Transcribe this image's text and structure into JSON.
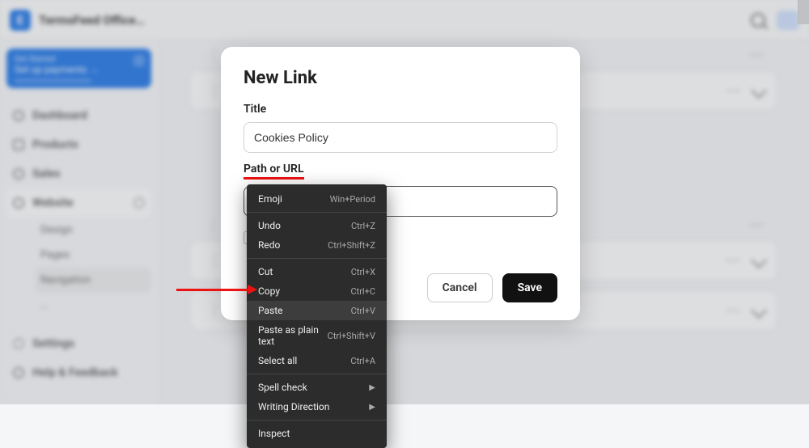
{
  "topbar": {
    "logo_letter": "E",
    "site_name": "TermsFeed Office…"
  },
  "sidebar": {
    "get_started": {
      "small": "Get Started",
      "main": "Set up payments  →"
    },
    "items": [
      {
        "label": "Dashboard"
      },
      {
        "label": "Products"
      },
      {
        "label": "Sales"
      },
      {
        "label": "Website"
      }
    ],
    "website_sub": [
      {
        "label": "Design"
      },
      {
        "label": "Pages"
      },
      {
        "label": "Navigation",
        "active": true
      }
    ],
    "bottom": [
      {
        "label": "Settings"
      },
      {
        "label": "Help & Feedback"
      }
    ]
  },
  "list_rows": {
    "handle_glyph": "⋮⋮"
  },
  "modal": {
    "title": "New Link",
    "title_label": "Title",
    "title_value": "Cookies Policy",
    "url_label": "Path or URL",
    "url_value": "",
    "cancel": "Cancel",
    "save": "Save"
  },
  "context_menu": {
    "items": [
      {
        "label": "Emoji",
        "shortcut": "Win+Period"
      },
      {
        "sep": true
      },
      {
        "label": "Undo",
        "shortcut": "Ctrl+Z"
      },
      {
        "label": "Redo",
        "shortcut": "Ctrl+Shift+Z"
      },
      {
        "sep": true
      },
      {
        "label": "Cut",
        "shortcut": "Ctrl+X"
      },
      {
        "label": "Copy",
        "shortcut": "Ctrl+C"
      },
      {
        "label": "Paste",
        "shortcut": "Ctrl+V",
        "highlight": true
      },
      {
        "label": "Paste as plain text",
        "shortcut": "Ctrl+Shift+V"
      },
      {
        "label": "Select all",
        "shortcut": "Ctrl+A"
      },
      {
        "sep": true
      },
      {
        "label": "Spell check",
        "submenu": true
      },
      {
        "label": "Writing Direction",
        "submenu": true
      },
      {
        "sep": true
      },
      {
        "label": "Inspect"
      }
    ]
  }
}
